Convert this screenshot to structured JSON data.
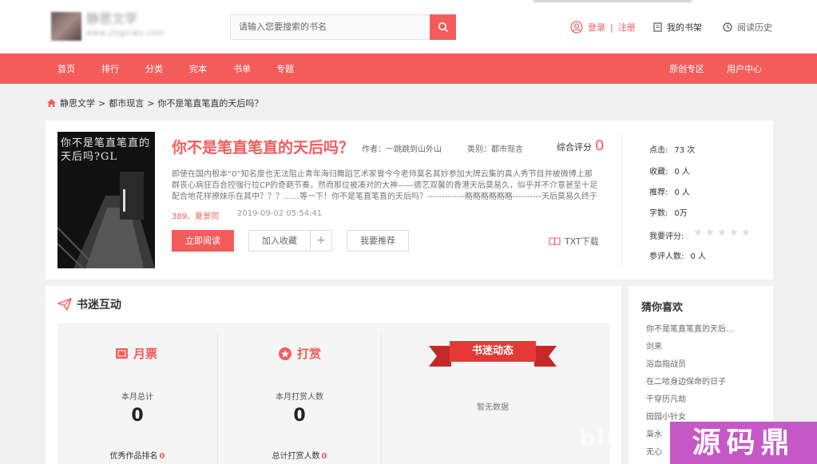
{
  "header": {
    "logo_text": "静思文学",
    "logo_sub": "www.jingsiwx.com",
    "search_placeholder": "请输入您要搜索的书名",
    "login": "登录",
    "sep": "|",
    "register": "注册",
    "shelf": "我的书架",
    "history": "阅读历史"
  },
  "nav": {
    "left": [
      "首页",
      "排行",
      "分类",
      "完本",
      "书单",
      "专题"
    ],
    "right": [
      "原创专区",
      "用户中心"
    ]
  },
  "breadcrumb": {
    "items": [
      "静思文学",
      "都市现言",
      "你不是笔直笔直的天后吗？"
    ],
    "sep": ">"
  },
  "book": {
    "cover_title": "你不是笔直笔直的天后吗?GL",
    "title": "你不是笔直笔直的天后吗？",
    "author_label": "作者：",
    "author": "一跳跳到山外山",
    "category_label": "类别：",
    "category": "都市现言",
    "score_label": "综合评分",
    "score": "0",
    "description": "即使在国内根本“0”知名度也无法阻止青年海归舞蹈艺术家曾今今老师莫名其妙参加大牌云集的真人秀节目并被微博上那群丧心病狂百合控强行拉CP的奇葩节奏，然而那位被凑对的大神——德艺双馨的香港天后莫易久，似乎并不介意甚至十足配合地花样撩妹乐在其中？？？……等一下！你不是笔直笔直的天后吗？-------------略略略略略略----------天后莫易久终于弯了，网友表示并不惊讶，纷……",
    "update_chapter": "389、夏景同",
    "update_time": "2019-09-02 05:54:41",
    "btn_read": "立即阅读",
    "btn_fav": "加入收藏",
    "btn_plus": "+",
    "btn_recommend": "我要推荐",
    "txt_download": "TXT下载"
  },
  "stats": {
    "clicks_label": "点击:",
    "clicks": "73 次",
    "favs_label": "收藏:",
    "favs": "0 人",
    "recs_label": "推荐:",
    "recs": "0 人",
    "words_label": "字数:",
    "words": "0万",
    "rate_label": "我要评分:",
    "rating": 0,
    "raters_label": "参评人数:",
    "raters": "0 人"
  },
  "interaction": {
    "title": "书迷互动",
    "monthly": {
      "title": "月票",
      "sub": "本月总计",
      "value": "0",
      "foot_label": "优秀作品排名",
      "foot_value": "0"
    },
    "reward": {
      "title": "打赏",
      "sub": "本月打赏人数",
      "value": "0",
      "foot_label": "总计打赏人数",
      "foot_value": "0"
    },
    "dynamics": {
      "title": "书迷动态",
      "empty": "暂无数据"
    }
  },
  "recommend": {
    "title": "猜你喜欢",
    "items": [
      "你不是笔直笔直的天后...",
      "剑来",
      "浴血指战员",
      "在二哈身边保命的日子",
      "千穿历凡劫",
      "田园小针女",
      "枭水",
      "无心"
    ]
  },
  "watermark": {
    "text": "源码鼎",
    "ghost": "blu"
  },
  "colors": {
    "accent": "#f45c5c",
    "ribbon": "#e53935"
  }
}
